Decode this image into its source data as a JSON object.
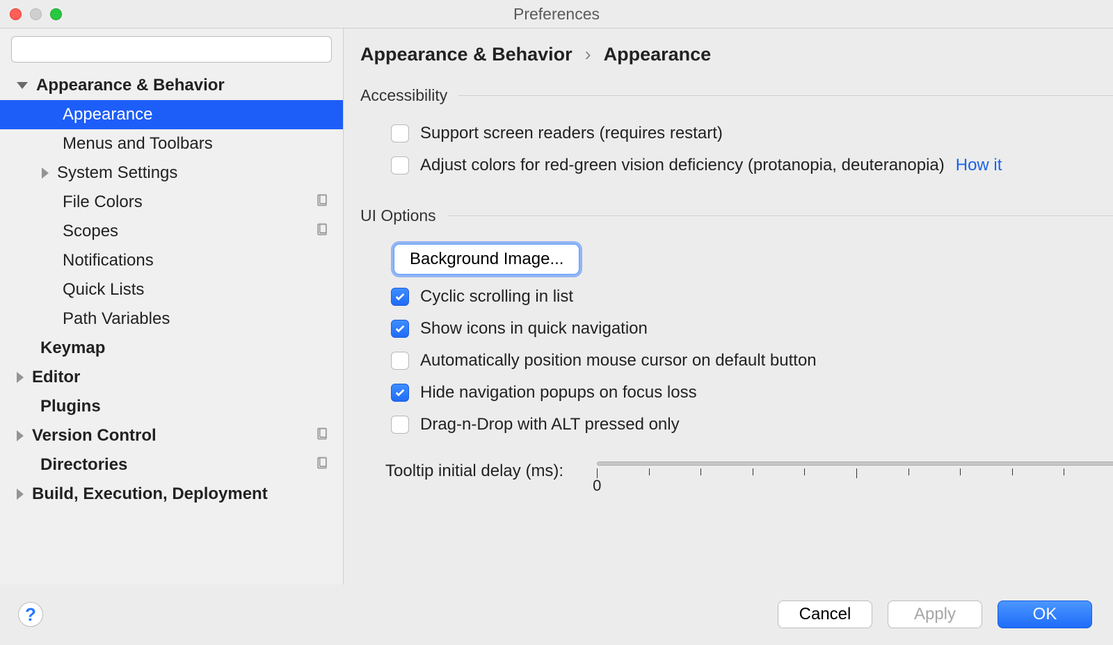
{
  "window": {
    "title": "Preferences"
  },
  "search": {
    "placeholder": ""
  },
  "sidebar": {
    "items": [
      {
        "label": "Appearance & Behavior",
        "level": "top",
        "expanded": true,
        "project": false
      },
      {
        "label": "Appearance",
        "level": "sub",
        "selected": true
      },
      {
        "label": "Menus and Toolbars",
        "level": "sub"
      },
      {
        "label": "System Settings",
        "level": "sub",
        "hasChildren": true
      },
      {
        "label": "File Colors",
        "level": "sub",
        "project": true
      },
      {
        "label": "Scopes",
        "level": "sub",
        "project": true
      },
      {
        "label": "Notifications",
        "level": "sub"
      },
      {
        "label": "Quick Lists",
        "level": "sub"
      },
      {
        "label": "Path Variables",
        "level": "sub"
      },
      {
        "label": "Keymap",
        "level": "top-no-arrow"
      },
      {
        "label": "Editor",
        "level": "top",
        "hasChildren": true
      },
      {
        "label": "Plugins",
        "level": "top-no-arrow"
      },
      {
        "label": "Version Control",
        "level": "top",
        "hasChildren": true,
        "project": true
      },
      {
        "label": "Directories",
        "level": "top-no-arrow",
        "project": true
      },
      {
        "label": "Build, Execution, Deployment",
        "level": "top",
        "hasChildren": true
      }
    ]
  },
  "breadcrumb": {
    "parent": "Appearance & Behavior",
    "sep": "›",
    "current": "Appearance"
  },
  "sections": {
    "accessibility": {
      "title": "Accessibility",
      "screenReaders": "Support screen readers (requires restart)",
      "colorAdjust": "Adjust colors for red-green vision deficiency (protanopia, deuteranopia)",
      "howItLink": "How it"
    },
    "uiOptions": {
      "title": "UI Options",
      "bgImageBtn": "Background Image...",
      "cyclic": "Cyclic scrolling in list",
      "icons": "Show icons in quick navigation",
      "mouseCursor": "Automatically position mouse cursor on default button",
      "hidePopups": "Hide navigation popups on focus loss",
      "dragDrop": "Drag-n-Drop with ALT pressed only",
      "tooltipLabel": "Tooltip initial delay (ms):",
      "tooltipValue": "0"
    }
  },
  "footer": {
    "cancel": "Cancel",
    "apply": "Apply",
    "ok": "OK"
  }
}
